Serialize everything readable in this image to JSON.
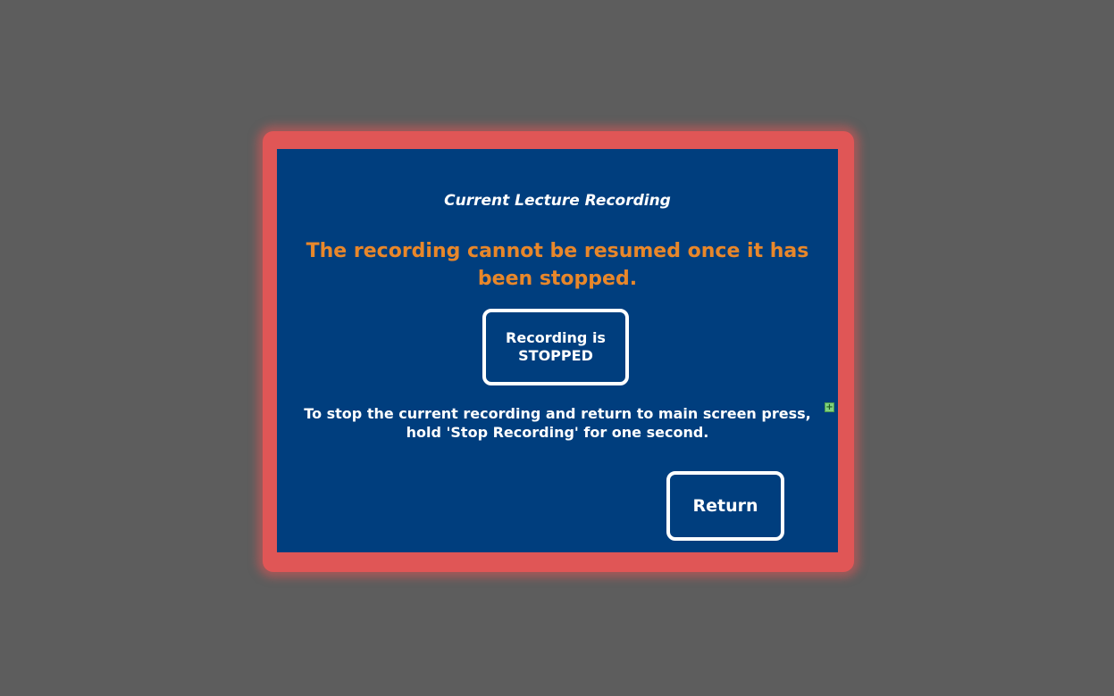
{
  "panel": {
    "title": "Current Lecture Recording",
    "warning": "The recording cannot be resumed once it has been stopped.",
    "status_line1": "Recording is",
    "status_line2": "STOPPED",
    "instruction_line1": "To stop the current recording and return to main screen press,",
    "instruction_line2": "hold 'Stop Recording' for one second.",
    "expand_icon": "+",
    "return_label": "Return"
  },
  "colors": {
    "background": "#5d5d5d",
    "frame": "#e05656",
    "panel": "#003e7e",
    "warning_text": "#e8872a",
    "text": "#ffffff"
  }
}
